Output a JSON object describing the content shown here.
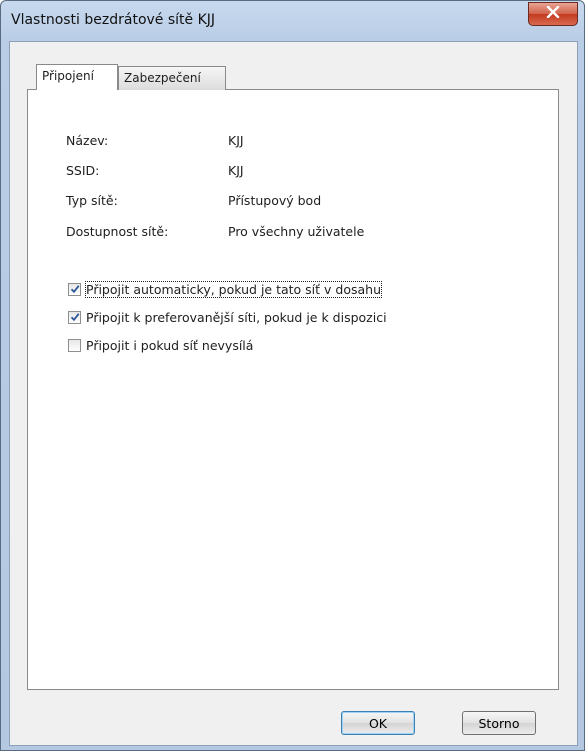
{
  "window": {
    "title": "Vlastnosti bezdrátové sítě KJJ"
  },
  "tabs": [
    {
      "label": "Připojení",
      "active": true
    },
    {
      "label": "Zabezpečení",
      "active": false
    }
  ],
  "properties": [
    {
      "label": "Název:",
      "value": "KJJ"
    },
    {
      "label": "SSID:",
      "value": "KJJ"
    },
    {
      "label": "Typ sítě:",
      "value": "Přístupový bod"
    },
    {
      "label": "Dostupnost sítě:",
      "value": "Pro všechny uživatele"
    }
  ],
  "options": [
    {
      "label": "Připojit automaticky, pokud je tato síť v dosahu",
      "checked": true
    },
    {
      "label": "Připojit k preferovanější síti, pokud je k dispozici",
      "checked": true
    },
    {
      "label": "Připojit i pokud síť nevysílá",
      "checked": false
    }
  ],
  "buttons": {
    "ok": "OK",
    "cancel": "Storno"
  },
  "colors": {
    "checkmark": "#2b5797",
    "close_glyph": "#ffffff"
  },
  "icons": {
    "close": "close-icon",
    "check": "checkmark-icon"
  }
}
